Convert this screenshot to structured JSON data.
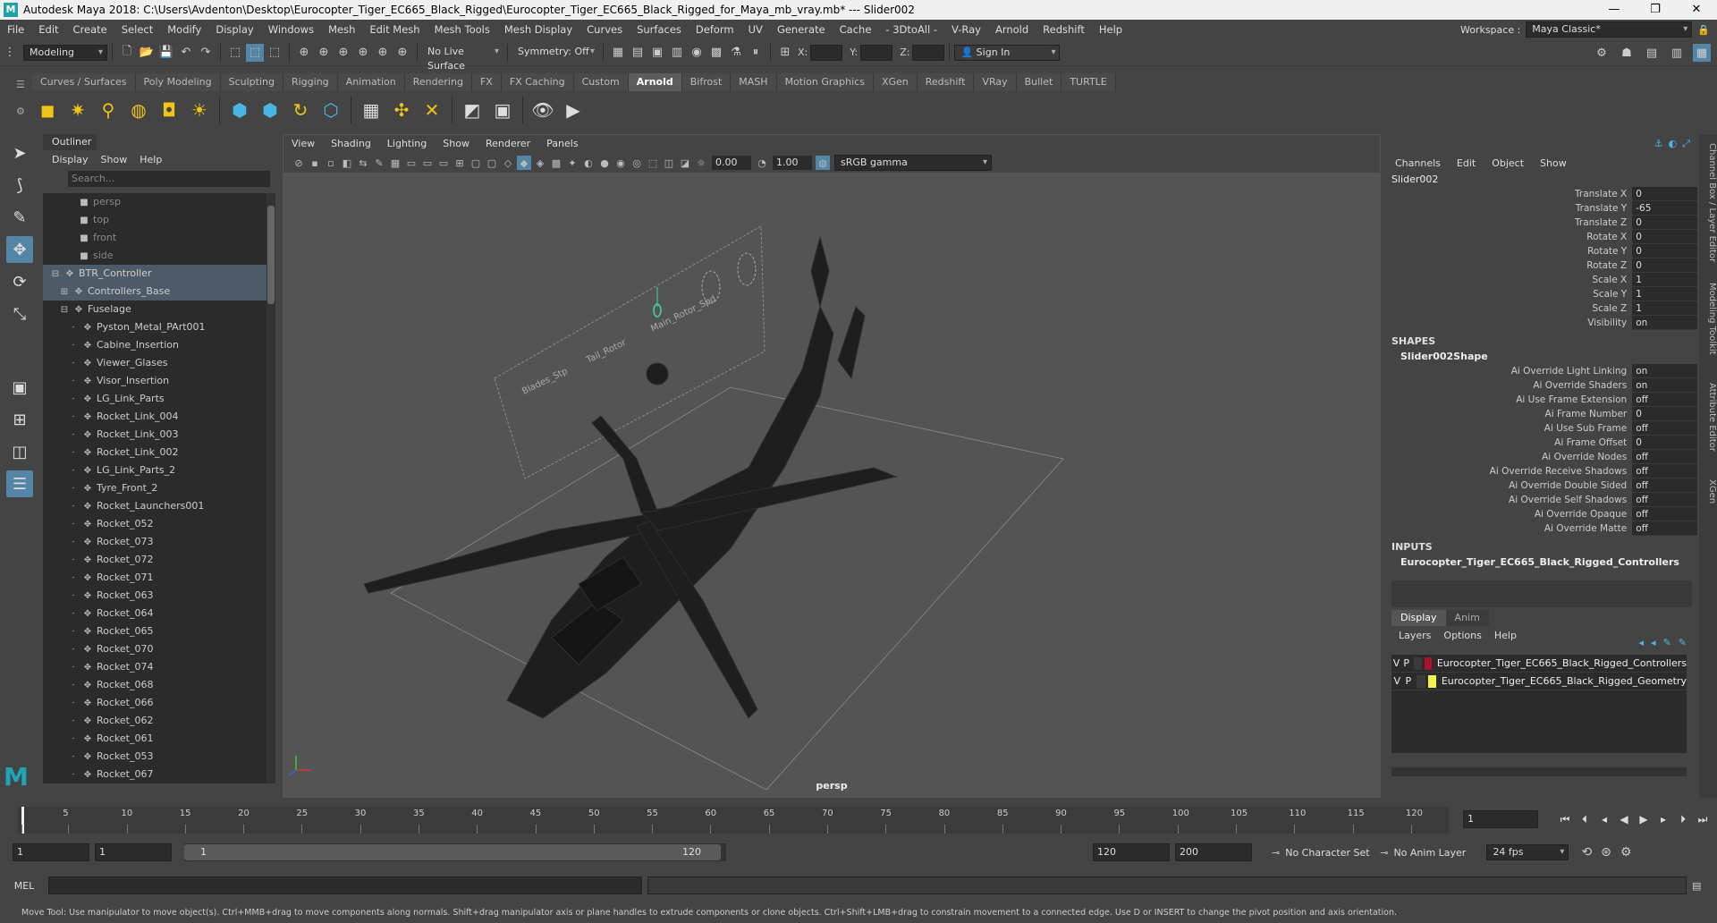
{
  "window": {
    "title": "Autodesk Maya 2018: C:\\Users\\Avdenton\\Desktop\\Eurocopter_Tiger_EC665_Black_Rigged\\Eurocopter_Tiger_EC665_Black_Rigged_for_Maya_mb_vray.mb*   ---   Slider002",
    "logo": "M"
  },
  "menubar": {
    "items": [
      "File",
      "Edit",
      "Create",
      "Select",
      "Modify",
      "Display",
      "Windows",
      "Mesh",
      "Edit Mesh",
      "Mesh Tools",
      "Mesh Display",
      "Curves",
      "Surfaces",
      "Deform",
      "UV",
      "Generate",
      "Cache",
      "- 3DtoAll -",
      "V-Ray",
      "Arnold",
      "Redshift",
      "Help"
    ],
    "workspace_label": "Workspace :",
    "workspace_value": "Maya Classic*"
  },
  "statusline": {
    "mode": "Modeling",
    "live_surface": "No Live Surface",
    "symmetry": "Symmetry: Off",
    "x_label": "X:",
    "y_label": "Y:",
    "z_label": "Z:",
    "sign_in": "Sign In"
  },
  "shelf": {
    "tabs": [
      "Curves / Surfaces",
      "Poly Modeling",
      "Sculpting",
      "Rigging",
      "Animation",
      "Rendering",
      "FX",
      "FX Caching",
      "Custom",
      "Arnold",
      "Bifrost",
      "MASH",
      "Motion Graphics",
      "XGen",
      "Redshift",
      "VRay",
      "Bullet",
      "TURTLE"
    ],
    "active_tab": "Arnold"
  },
  "outliner": {
    "title": "Outliner",
    "menus": [
      "Display",
      "Show",
      "Help"
    ],
    "search_placeholder": "Search...",
    "rows": [
      {
        "label": "persp",
        "type": "cam",
        "indent": 0
      },
      {
        "label": "top",
        "type": "cam",
        "indent": 0
      },
      {
        "label": "front",
        "type": "cam",
        "indent": 0
      },
      {
        "label": "side",
        "type": "cam",
        "indent": 0
      },
      {
        "label": "BTR_Controller",
        "type": "node",
        "indent": 0,
        "expander": "⊟",
        "selected": true
      },
      {
        "label": "Controllers_Base",
        "type": "node",
        "indent": 1,
        "expander": "⊞",
        "selected": true
      },
      {
        "label": "Fuselage",
        "type": "node",
        "indent": 1,
        "expander": "⊟"
      },
      {
        "label": "Pyston_Metal_PArt001",
        "type": "node",
        "indent": 2
      },
      {
        "label": "Cabine_Insertion",
        "type": "node",
        "indent": 2
      },
      {
        "label": "Viewer_Glases",
        "type": "node",
        "indent": 2
      },
      {
        "label": "Visor_Insertion",
        "type": "node",
        "indent": 2
      },
      {
        "label": "LG_Link_Parts",
        "type": "node",
        "indent": 2
      },
      {
        "label": "Rocket_Link_004",
        "type": "node",
        "indent": 2
      },
      {
        "label": "Rocket_Link_003",
        "type": "node",
        "indent": 2
      },
      {
        "label": "Rocket_Link_002",
        "type": "node",
        "indent": 2
      },
      {
        "label": "LG_Link_Parts_2",
        "type": "node",
        "indent": 2
      },
      {
        "label": "Tyre_Front_2",
        "type": "node",
        "indent": 2
      },
      {
        "label": "Rocket_Launchers001",
        "type": "node",
        "indent": 2
      },
      {
        "label": "Rocket_052",
        "type": "node",
        "indent": 2
      },
      {
        "label": "Rocket_073",
        "type": "node",
        "indent": 2
      },
      {
        "label": "Rocket_072",
        "type": "node",
        "indent": 2
      },
      {
        "label": "Rocket_071",
        "type": "node",
        "indent": 2
      },
      {
        "label": "Rocket_063",
        "type": "node",
        "indent": 2
      },
      {
        "label": "Rocket_064",
        "type": "node",
        "indent": 2
      },
      {
        "label": "Rocket_065",
        "type": "node",
        "indent": 2
      },
      {
        "label": "Rocket_070",
        "type": "node",
        "indent": 2
      },
      {
        "label": "Rocket_074",
        "type": "node",
        "indent": 2
      },
      {
        "label": "Rocket_068",
        "type": "node",
        "indent": 2
      },
      {
        "label": "Rocket_066",
        "type": "node",
        "indent": 2
      },
      {
        "label": "Rocket_062",
        "type": "node",
        "indent": 2
      },
      {
        "label": "Rocket_061",
        "type": "node",
        "indent": 2
      },
      {
        "label": "Rocket_053",
        "type": "node",
        "indent": 2
      },
      {
        "label": "Rocket_067",
        "type": "node",
        "indent": 2
      }
    ]
  },
  "viewport": {
    "menus": [
      "View",
      "Shading",
      "Lighting",
      "Show",
      "Renderer",
      "Panels"
    ],
    "exposure": "0.00",
    "gamma": "1.00",
    "color_space": "sRGB gamma",
    "camera_label": "persp",
    "slider_texts": [
      "Blades_Stp",
      "Tail_Rotor",
      "Main_Rotor_Spd"
    ]
  },
  "channelbox": {
    "menus": [
      "Channels",
      "Edit",
      "Object",
      "Show"
    ],
    "node": "Slider002",
    "attrs": [
      {
        "label": "Translate X",
        "value": "0"
      },
      {
        "label": "Translate Y",
        "value": "-65"
      },
      {
        "label": "Translate Z",
        "value": "0"
      },
      {
        "label": "Rotate X",
        "value": "0"
      },
      {
        "label": "Rotate Y",
        "value": "0"
      },
      {
        "label": "Rotate Z",
        "value": "0"
      },
      {
        "label": "Scale X",
        "value": "1"
      },
      {
        "label": "Scale Y",
        "value": "1"
      },
      {
        "label": "Scale Z",
        "value": "1"
      },
      {
        "label": "Visibility",
        "value": "on"
      }
    ],
    "shapes_header": "SHAPES",
    "shape_node": "Slider002Shape",
    "shape_attrs": [
      {
        "label": "Ai Override Light Linking",
        "value": "on"
      },
      {
        "label": "Ai Override Shaders",
        "value": "on"
      },
      {
        "label": "Ai Use Frame Extension",
        "value": "off"
      },
      {
        "label": "Ai Frame Number",
        "value": "0"
      },
      {
        "label": "Ai Use Sub Frame",
        "value": "off"
      },
      {
        "label": "Ai Frame Offset",
        "value": "0"
      },
      {
        "label": "Ai Override Nodes",
        "value": "off"
      },
      {
        "label": "Ai Override Receive Shadows",
        "value": "off"
      },
      {
        "label": "Ai Override Double Sided",
        "value": "off"
      },
      {
        "label": "Ai Override Self Shadows",
        "value": "off"
      },
      {
        "label": "Ai Override Opaque",
        "value": "off"
      },
      {
        "label": "Ai Override Matte",
        "value": "off"
      }
    ],
    "inputs_header": "INPUTS",
    "input_node": "Eurocopter_Tiger_EC665_Black_Rigged_Controllers"
  },
  "layers": {
    "tabs": [
      "Display",
      "Anim"
    ],
    "menus": [
      "Layers",
      "Options",
      "Help"
    ],
    "rows": [
      {
        "v": "V",
        "p": "P",
        "color": "#b0102a",
        "name": "Eurocopter_Tiger_EC665_Black_Rigged_Controllers"
      },
      {
        "v": "V",
        "p": "P",
        "color": "#f5f04a",
        "name": "Eurocopter_Tiger_EC665_Black_Rigged_Geometry"
      }
    ]
  },
  "sidetabs": [
    "Channel Box / Layer Editor",
    "Modeling Toolkit",
    "Attribute Editor",
    "XGen"
  ],
  "timeline": {
    "ticks": [
      1,
      5,
      10,
      15,
      20,
      25,
      30,
      35,
      40,
      45,
      50,
      55,
      60,
      65,
      70,
      75,
      80,
      85,
      90,
      95,
      100,
      105,
      110,
      115,
      120
    ],
    "current_frame": "1"
  },
  "range": {
    "start": "1",
    "anim_start": "1",
    "range_start_label": "1",
    "range_end_label": "120",
    "end": "120",
    "anim_end": "200",
    "character_set": "No Character Set",
    "anim_layer": "No Anim Layer",
    "fps": "24 fps"
  },
  "mel": {
    "label": "MEL"
  },
  "help_line": "Move Tool: Use manipulator to move object(s). Ctrl+MMB+drag to move components along normals. Shift+drag manipulator axis or plane handles to extrude components or clone objects. Ctrl+Shift+LMB+drag to constrain movement to a connected edge. Use D or INSERT to change the pivot position and axis orientation."
}
